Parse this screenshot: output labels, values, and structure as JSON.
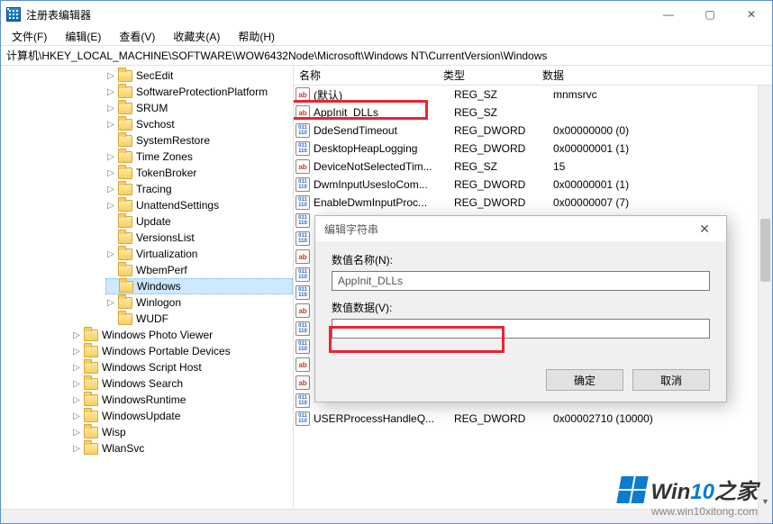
{
  "window": {
    "title": "注册表编辑器"
  },
  "menu": {
    "file": "文件(F)",
    "edit": "编辑(E)",
    "view": "查看(V)",
    "favorites": "收藏夹(A)",
    "help": "帮助(H)"
  },
  "address": "计算机\\HKEY_LOCAL_MACHINE\\SOFTWARE\\WOW6432Node\\Microsoft\\Windows NT\\CurrentVersion\\Windows",
  "tree": {
    "items": [
      {
        "label": "SecEdit",
        "exp": "▷"
      },
      {
        "label": "SoftwareProtectionPlatform",
        "exp": "▷"
      },
      {
        "label": "SRUM",
        "exp": "▷"
      },
      {
        "label": "Svchost",
        "exp": "▷"
      },
      {
        "label": "SystemRestore",
        "exp": ""
      },
      {
        "label": "Time Zones",
        "exp": "▷"
      },
      {
        "label": "TokenBroker",
        "exp": "▷"
      },
      {
        "label": "Tracing",
        "exp": "▷"
      },
      {
        "label": "UnattendSettings",
        "exp": "▷"
      },
      {
        "label": "Update",
        "exp": ""
      },
      {
        "label": "VersionsList",
        "exp": ""
      },
      {
        "label": "Virtualization",
        "exp": "▷"
      },
      {
        "label": "WbemPerf",
        "exp": ""
      },
      {
        "label": "Windows",
        "exp": "",
        "selected": true
      },
      {
        "label": "Winlogon",
        "exp": "▷"
      },
      {
        "label": "WUDF",
        "exp": ""
      }
    ],
    "below": [
      {
        "label": "Windows Photo Viewer",
        "exp": "▷"
      },
      {
        "label": "Windows Portable Devices",
        "exp": "▷"
      },
      {
        "label": "Windows Script Host",
        "exp": "▷"
      },
      {
        "label": "Windows Search",
        "exp": "▷"
      },
      {
        "label": "WindowsRuntime",
        "exp": "▷"
      },
      {
        "label": "WindowsUpdate",
        "exp": "▷"
      },
      {
        "label": "Wisp",
        "exp": "▷"
      },
      {
        "label": "WlanSvc",
        "exp": "▷"
      }
    ]
  },
  "columns": {
    "name": "名称",
    "type": "类型",
    "data": "数据"
  },
  "values": [
    {
      "ico": "sz",
      "name": "(默认)",
      "type": "REG_SZ",
      "data": "mnmsrvc"
    },
    {
      "ico": "sz",
      "name": "AppInit_DLLs",
      "type": "REG_SZ",
      "data": ""
    },
    {
      "ico": "dw",
      "name": "DdeSendTimeout",
      "type": "REG_DWORD",
      "data": "0x00000000 (0)"
    },
    {
      "ico": "dw",
      "name": "DesktopHeapLogging",
      "type": "REG_DWORD",
      "data": "0x00000001 (1)"
    },
    {
      "ico": "sz",
      "name": "DeviceNotSelectedTim...",
      "type": "REG_SZ",
      "data": "15"
    },
    {
      "ico": "dw",
      "name": "DwmInputUsesIoCom...",
      "type": "REG_DWORD",
      "data": "0x00000001 (1)"
    },
    {
      "ico": "dw",
      "name": "EnableDwmInputProc...",
      "type": "REG_DWORD",
      "data": "0x00000007 (7)"
    },
    {
      "ico": "dw",
      "name": "",
      "type": "",
      "data": ""
    },
    {
      "ico": "dw",
      "name": "",
      "type": "",
      "data": ""
    },
    {
      "ico": "sz",
      "name": "",
      "type": "",
      "data": ""
    },
    {
      "ico": "dw",
      "name": "",
      "type": "",
      "data": ""
    },
    {
      "ico": "dw",
      "name": "",
      "type": "",
      "data": ""
    },
    {
      "ico": "sz",
      "name": "",
      "type": "",
      "data": ""
    },
    {
      "ico": "dw",
      "name": "",
      "type": "",
      "data": ""
    },
    {
      "ico": "dw",
      "name": "",
      "type": "",
      "data": ""
    },
    {
      "ico": "sz",
      "name": "",
      "type": "",
      "data": ""
    },
    {
      "ico": "sz",
      "name": "",
      "type": "",
      "data": ""
    },
    {
      "ico": "dw",
      "name": "",
      "type": "",
      "data": ""
    },
    {
      "ico": "dw",
      "name": "USERProcessHandleQ...",
      "type": "REG_DWORD",
      "data": "0x00002710 (10000)"
    }
  ],
  "dialog": {
    "title": "编辑字符串",
    "name_label": "数值名称(N):",
    "name_value": "AppInit_DLLs",
    "data_label": "数值数据(V):",
    "data_value": "",
    "ok": "确定",
    "cancel": "取消"
  },
  "watermark": {
    "brand_a": "Win",
    "brand_b": "10",
    "brand_suffix": "之家",
    "url": "www.win10xitong.com"
  }
}
